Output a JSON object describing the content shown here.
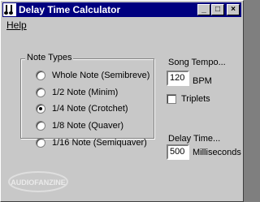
{
  "window": {
    "title": "Delay Time Calculator"
  },
  "menubar": {
    "items": [
      {
        "label": "Help"
      }
    ]
  },
  "note_types": {
    "group_label": "Note Types",
    "options": [
      {
        "label": "Whole Note (Semibreve)",
        "checked": false
      },
      {
        "label": "1/2 Note (Minim)",
        "checked": false
      },
      {
        "label": "1/4 Note (Crotchet)",
        "checked": true
      },
      {
        "label": "1/8 Note (Quaver)",
        "checked": false
      },
      {
        "label": "1/16 Note (Semiquaver)",
        "checked": false
      }
    ]
  },
  "tempo": {
    "label": "Song Tempo...",
    "value": "120",
    "unit": "BPM",
    "triplets_label": "Triplets",
    "triplets_checked": false
  },
  "delay": {
    "label": "Delay Time...",
    "value": "500",
    "unit": "Milliseconds"
  },
  "watermark": {
    "text": "AUDIOFANZINE"
  }
}
